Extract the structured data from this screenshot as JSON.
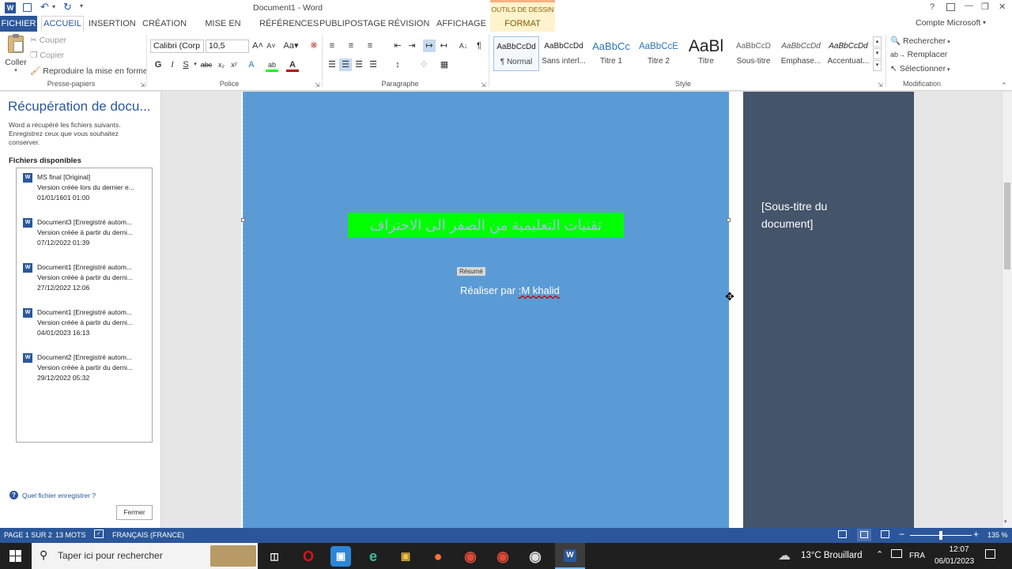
{
  "window": {
    "title": "Document1 - Word",
    "help": "?",
    "minimize": "—",
    "restore": "❐",
    "close": "✕",
    "account": "Compte Microsoft"
  },
  "tabs": {
    "file": "FICHIER",
    "home": "ACCUEIL",
    "insert": "INSERTION",
    "design": "CRÉATION",
    "layout": "MISE EN PAGE",
    "references": "RÉFÉRENCES",
    "mailings": "PUBLIPOSTAGE",
    "review": "RÉVISION",
    "view": "AFFICHAGE",
    "context_header": "OUTILS DE DESSIN",
    "format": "FORMAT"
  },
  "clipboard": {
    "paste": "Coller",
    "cut": "Couper",
    "copy": "Copier",
    "format_painter": "Reproduire la mise en forme",
    "label": "Presse-papiers"
  },
  "font": {
    "name": "Calibri (Corp",
    "size": "10,5",
    "label": "Police"
  },
  "paragraph": {
    "label": "Paragraphe"
  },
  "styles": {
    "label": "Style",
    "items": [
      {
        "sample": "AaBbCcDd",
        "name": "¶ Normal"
      },
      {
        "sample": "AaBbCcDd",
        "name": "Sans interl..."
      },
      {
        "sample": "AaBbCc",
        "name": "Titre 1"
      },
      {
        "sample": "AaBbCcE",
        "name": "Titre 2"
      },
      {
        "sample": "AaBl",
        "name": "Titre"
      },
      {
        "sample": "AaBbCcD",
        "name": "Sous-titre"
      },
      {
        "sample": "AaBbCcDd",
        "name": "Emphase..."
      },
      {
        "sample": "AaBbCcDd",
        "name": "Accentuat..."
      }
    ]
  },
  "editing": {
    "find": "Rechercher",
    "replace": "Remplacer",
    "select": "Sélectionner",
    "label": "Modification"
  },
  "recovery": {
    "title": "Récupération de docu...",
    "description": "Word a récupéré les fichiers suivants. Enregistrez ceux que vous souhaitez conserver.",
    "files_heading": "Fichiers disponibles",
    "files": [
      {
        "name": "MS final  [Original]",
        "version": "Version créée lors du dernier e...",
        "date": "01/01/1601 01:00"
      },
      {
        "name": "Document3  [Enregistré autom...",
        "version": "Version créée à partir du derni...",
        "date": "07/12/2022 01:39"
      },
      {
        "name": "Document1  [Enregistré autom...",
        "version": "Version créée à partir du derni...",
        "date": "27/12/2022 12:06"
      },
      {
        "name": "Document1  [Enregistré autom...",
        "version": "Version créée à partir du derni...",
        "date": "04/01/2023 16:13"
      },
      {
        "name": "Document2  [Enregistré autom...",
        "version": "Version créée à partir du derni...",
        "date": "29/12/2022 05:32"
      }
    ],
    "help_link": "Quel fichier enregistrer ?",
    "close_button": "Fermer"
  },
  "document": {
    "arabic_title": "تقنيات التعليمية من الصفر الى الاحتراف",
    "abstract_tag": "Résumé",
    "author_prefix": "Réaliser par ",
    "author_name": ":M khalid",
    "subtitle": "[Sous-titre du document]",
    "colors": {
      "left_panel": "#5b9bd5",
      "right_panel": "#44546a",
      "highlight": "#00ff00"
    }
  },
  "status": {
    "page": "PAGE 1 SUR 2",
    "words": "13 MOTS",
    "language": "FRANÇAIS (FRANCE)",
    "zoom": "135 %"
  },
  "taskbar": {
    "search_placeholder": "Taper ici pour rechercher",
    "weather": "13°C  Brouillard",
    "lang": "FRA",
    "time": "12:07",
    "date": "06/01/2023"
  }
}
